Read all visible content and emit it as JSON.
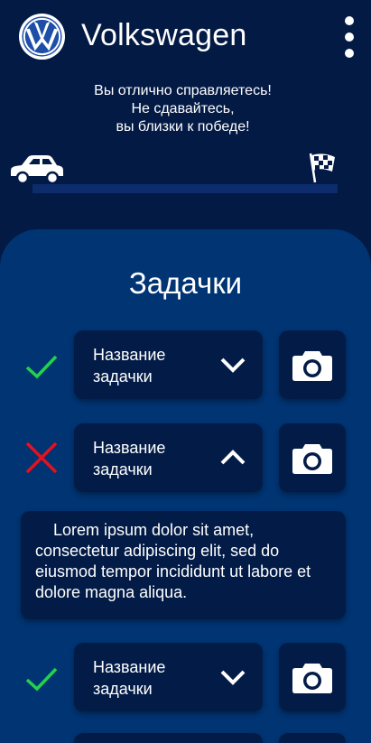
{
  "app": {
    "title": "Volkswagen",
    "logo_icon": "vw-logo-icon",
    "menu_icon": "more-vert-icon"
  },
  "motivation": {
    "line1": "Вы отлично справляетесь!",
    "line2": "Не сдавайтесь,",
    "line3": "вы близки к победе!"
  },
  "progress": {
    "start_icon": "car-icon",
    "finish_icon": "checkered-flag-icon",
    "value": 0
  },
  "tasks_panel": {
    "title": "Задачки",
    "tasks": [
      {
        "name": "Название задачки",
        "status": "done",
        "status_icon": "checkmark-icon",
        "expanded": false,
        "action_icon": "camera-icon"
      },
      {
        "name": "Название задачки",
        "status": "failed",
        "status_icon": "cross-icon",
        "expanded": true,
        "action_icon": "camera-icon",
        "description": "Lorem ipsum dolor sit amet, consectetur adipiscing elit, sed do eiusmod tempor incididunt ut labore et dolore magna aliqua."
      },
      {
        "name": "Название задачки",
        "status": "done",
        "status_icon": "checkmark-icon",
        "expanded": false,
        "action_icon": "camera-icon"
      }
    ]
  },
  "colors": {
    "background": "#031a45",
    "panel": "#003473",
    "card": "#031c47",
    "success": "#22d34a",
    "error": "#e3121f",
    "logo_blue": "#1e4fa8"
  }
}
